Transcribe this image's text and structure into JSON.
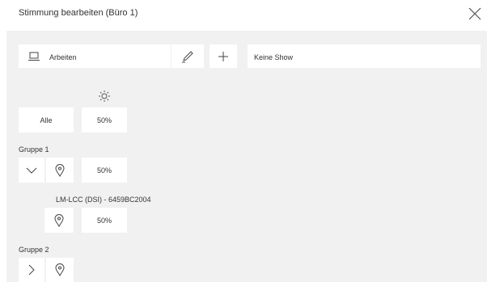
{
  "header": {
    "title": "Stimmung bearbeiten (Büro 1)"
  },
  "toolbar": {
    "scene_name": "Arbeiten",
    "show_name": "Keine Show"
  },
  "all_row": {
    "label": "Alle",
    "value": "50%"
  },
  "groups": [
    {
      "label": "Gruppe 1",
      "value": "50%",
      "expanded": true,
      "devices": [
        {
          "label": "LM-LCC (DSI) - 6459BC2004",
          "value": "50%"
        }
      ]
    },
    {
      "label": "Gruppe 2",
      "expanded": false
    }
  ],
  "icons": {
    "close": "close-icon",
    "laptop": "laptop-icon",
    "edit": "pencil-icon",
    "add": "plus-icon",
    "brightness": "sun-icon",
    "locate": "location-pin-icon",
    "expand": "chevron-down-icon",
    "collapse": "chevron-right-icon"
  },
  "colors": {
    "background": "#f1f1f1",
    "card": "#ffffff",
    "text": "#333333"
  }
}
